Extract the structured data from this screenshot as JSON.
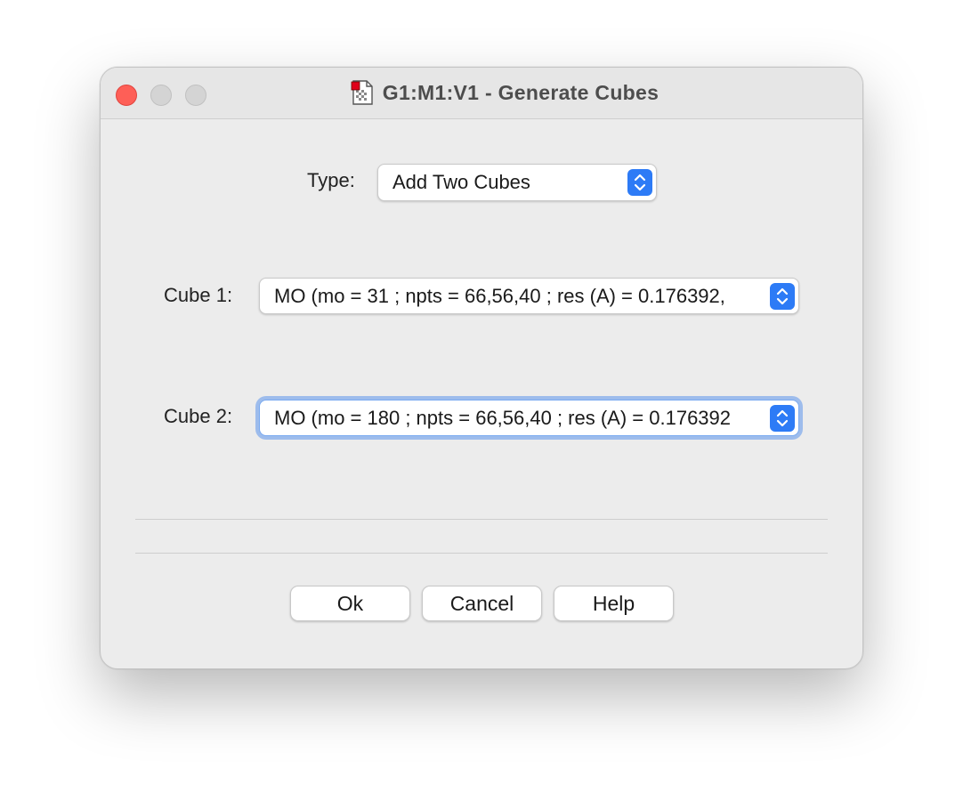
{
  "window": {
    "title": "G1:M1:V1 - Generate Cubes",
    "title_icon": "document-icon"
  },
  "type_field": {
    "label": "Type:",
    "selected": "Add Two Cubes"
  },
  "cube1": {
    "label": "Cube 1:",
    "selected": "MO (mo = 31 ; npts = 66,56,40 ; res (A) = 0.176392,"
  },
  "cube2": {
    "label": "Cube 2:",
    "selected": "MO (mo = 180 ; npts = 66,56,40 ; res (A) = 0.176392"
  },
  "buttons": {
    "ok": "Ok",
    "cancel": "Cancel",
    "help": "Help"
  },
  "colors": {
    "accent": "#2d7bf6",
    "close": "#fe5f57",
    "window_bg": "#ececec"
  }
}
